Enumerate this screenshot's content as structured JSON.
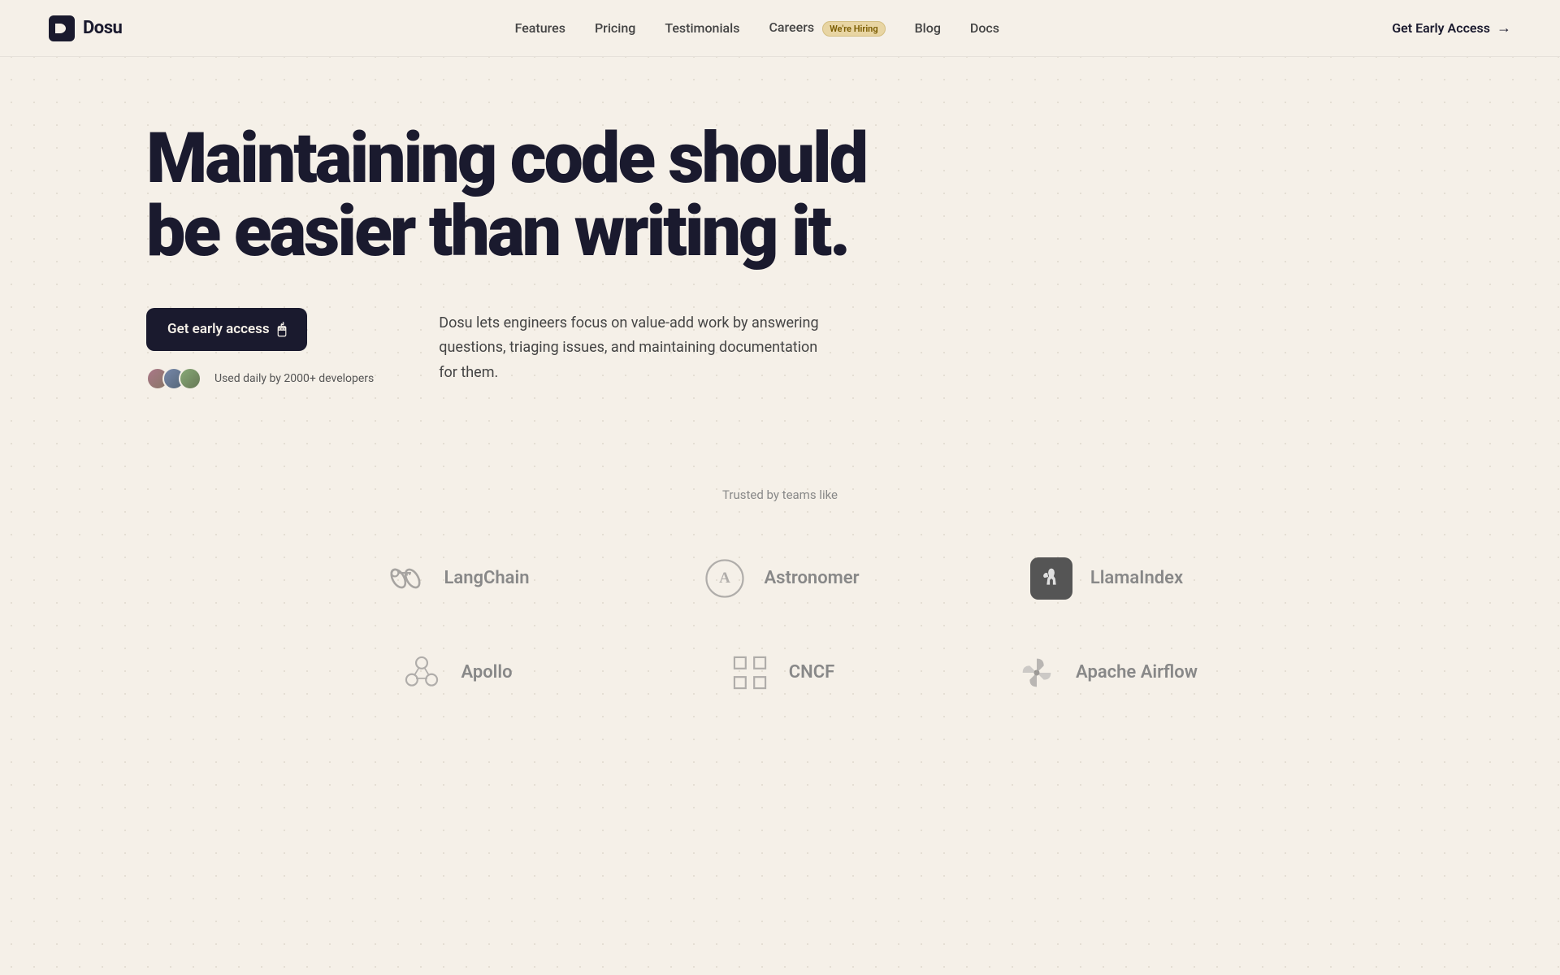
{
  "brand": {
    "name": "Dosu",
    "logo_alt": "Dosu logo"
  },
  "nav": {
    "links": [
      {
        "label": "Features",
        "href": "#features"
      },
      {
        "label": "Pricing",
        "href": "#pricing"
      },
      {
        "label": "Testimonials",
        "href": "#testimonials"
      },
      {
        "label": "Careers",
        "href": "#careers",
        "badge": "We're Hiring"
      },
      {
        "label": "Blog",
        "href": "#blog"
      },
      {
        "label": "Docs",
        "href": "#docs"
      }
    ],
    "cta_label": "Get Early Access",
    "cta_arrow": "→"
  },
  "hero": {
    "headline": "Maintaining code should be easier than writing it.",
    "cta_button_label": "Get early access",
    "description": "Dosu lets engineers focus on value-add work by answering questions, triaging issues, and maintaining documentation for them.",
    "social_proof_text": "Used daily by 2000+ developers"
  },
  "trusted": {
    "label": "Trusted by teams like",
    "companies": [
      {
        "name": "LangChain",
        "icon_type": "langchain"
      },
      {
        "name": "Astronomer",
        "icon_type": "astronomer"
      },
      {
        "name": "LlamaIndex",
        "icon_type": "llama"
      },
      {
        "name": "Apollo",
        "icon_type": "apollo"
      },
      {
        "name": "CNCF",
        "icon_type": "cncf"
      },
      {
        "name": "Apache Airflow",
        "icon_type": "airflow"
      }
    ]
  },
  "colors": {
    "bg": "#f5f0e8",
    "nav_dark": "#1a1a2e",
    "text_dark": "#1a1a2e",
    "text_muted": "#888",
    "badge_bg": "#e8d5a3",
    "badge_text": "#7a5c00"
  }
}
